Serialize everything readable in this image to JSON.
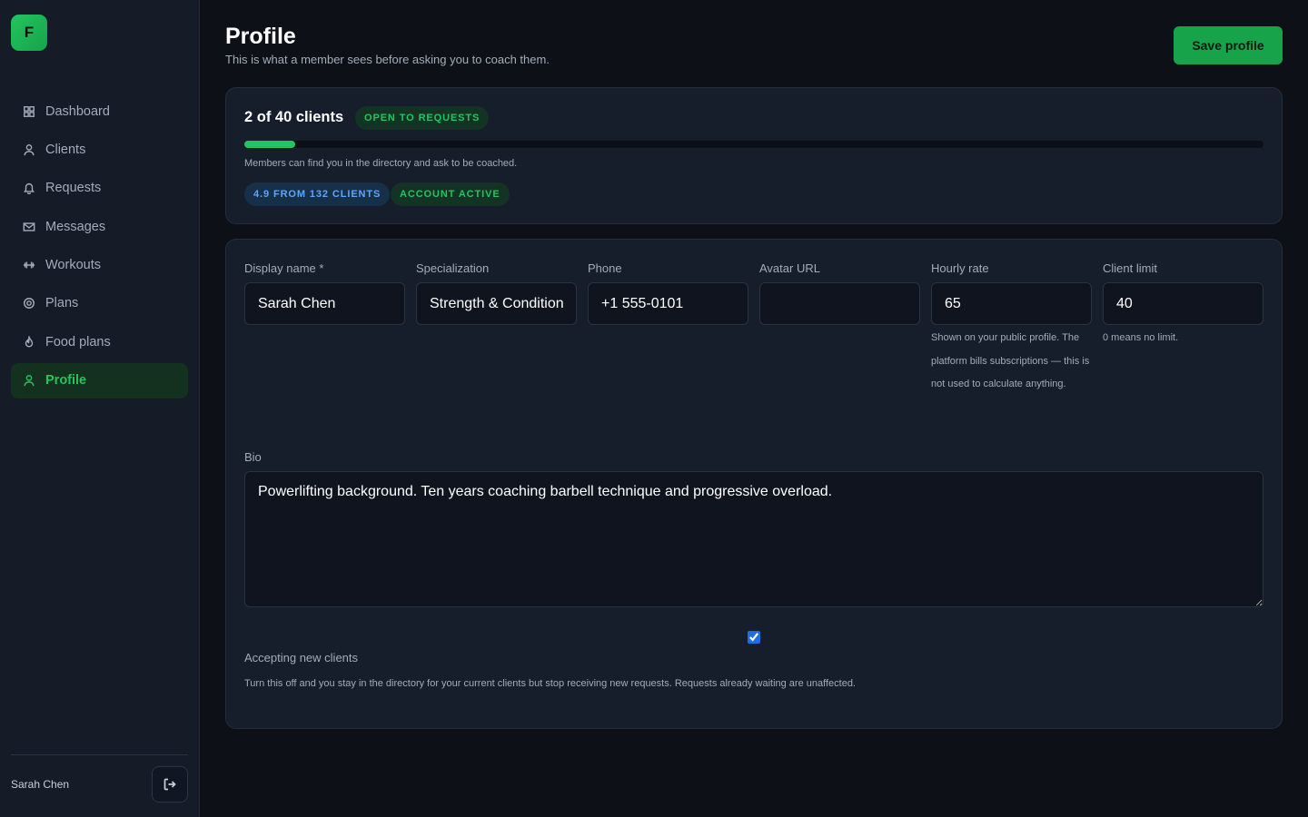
{
  "brand": {
    "logo_letter": "F",
    "accent": "#22c55e"
  },
  "sidebar": {
    "items": [
      {
        "label": "Dashboard",
        "icon": "grid-icon"
      },
      {
        "label": "Clients",
        "icon": "user-icon"
      },
      {
        "label": "Requests",
        "icon": "bell-icon"
      },
      {
        "label": "Messages",
        "icon": "mail-icon"
      },
      {
        "label": "Workouts",
        "icon": "dumbbell-icon"
      },
      {
        "label": "Plans",
        "icon": "target-icon"
      },
      {
        "label": "Food plans",
        "icon": "flame-icon"
      },
      {
        "label": "Profile",
        "icon": "user-icon",
        "active": true
      }
    ],
    "user_name": "Sarah Chen",
    "logout_icon": "logout-icon"
  },
  "header": {
    "title": "Profile",
    "subtitle": "This is what a member sees before asking you to coach them.",
    "save_label": "Save profile"
  },
  "status": {
    "clients_text": "2 of 40 clients",
    "current_clients": 2,
    "client_limit": 40,
    "open_badge": "OPEN TO REQUESTS",
    "directory_note": "Members can find you in the directory and ask to be coached.",
    "rating_badge": "4.9 FROM 132 CLIENTS",
    "account_badge": "ACCOUNT ACTIVE"
  },
  "form": {
    "display_name": {
      "label": "Display name *",
      "value": "Sarah Chen"
    },
    "specialization": {
      "label": "Specialization",
      "value": "Strength & Conditioning"
    },
    "phone": {
      "label": "Phone",
      "value": "+1 555-0101"
    },
    "avatar_url": {
      "label": "Avatar URL",
      "value": ""
    },
    "hourly_rate": {
      "label": "Hourly rate",
      "value": "65",
      "help": "Shown on your public profile. The platform bills subscriptions — this is not used to calculate anything."
    },
    "client_limit": {
      "label": "Client limit",
      "value": "40",
      "help": "0 means no limit."
    },
    "bio": {
      "label": "Bio",
      "value": "Powerlifting background. Ten years coaching barbell technique and progressive overload."
    },
    "accepting": {
      "label": "Accepting new clients",
      "checked": true,
      "help": "Turn this off and you stay in the directory for your current clients but stop receiving new requests. Requests already waiting are unaffected."
    }
  }
}
